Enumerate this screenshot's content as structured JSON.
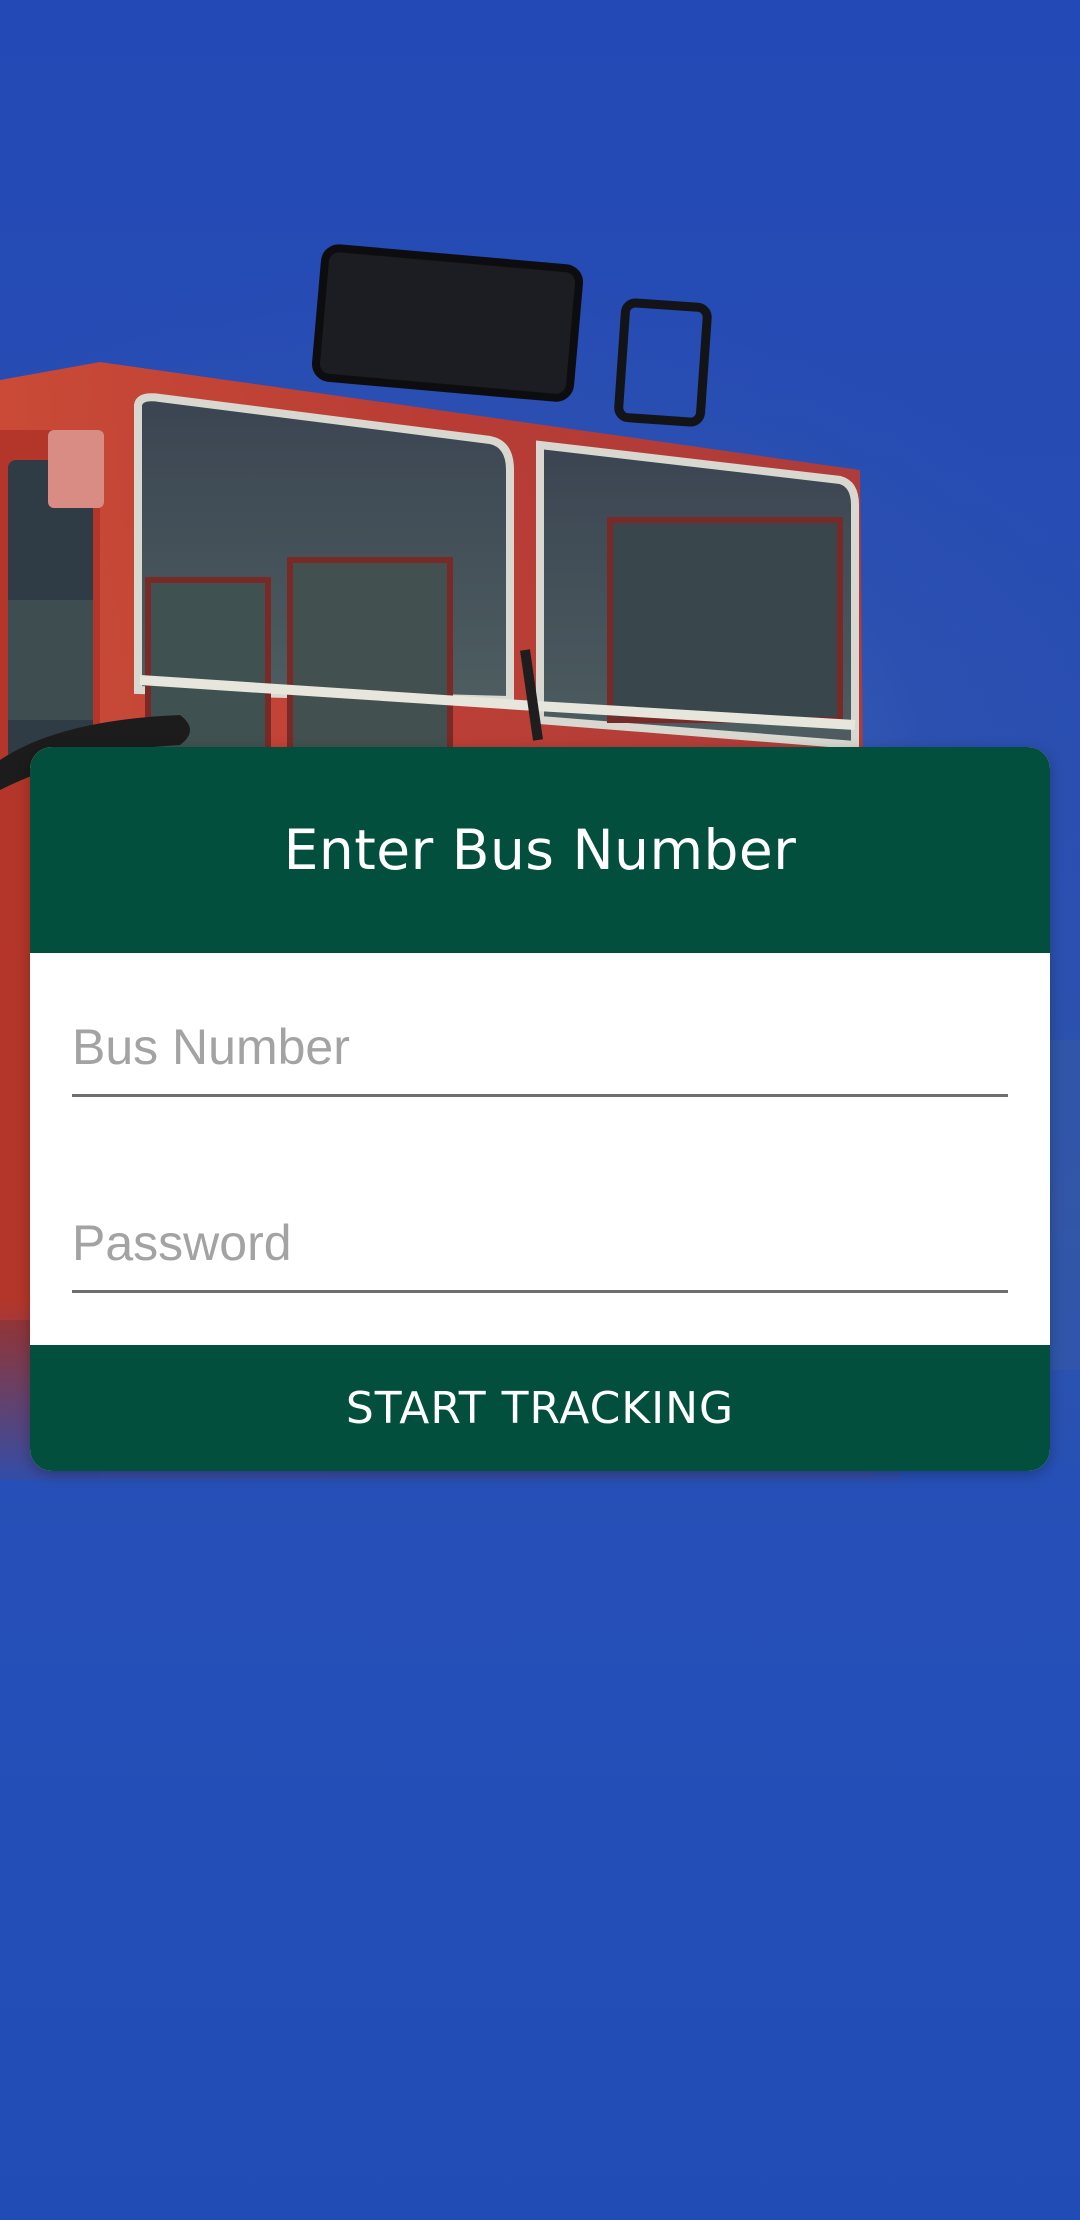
{
  "card": {
    "title": "Enter Bus Number",
    "bus_number": {
      "placeholder": "Bus Number",
      "value": ""
    },
    "password": {
      "placeholder": "Password",
      "value": ""
    },
    "button_label": "START TRACKING"
  },
  "colors": {
    "background": "#214cb6",
    "card_accent": "#024f3d",
    "bus_body": "#c8442c"
  },
  "background_image": {
    "subject": "red bus front"
  }
}
